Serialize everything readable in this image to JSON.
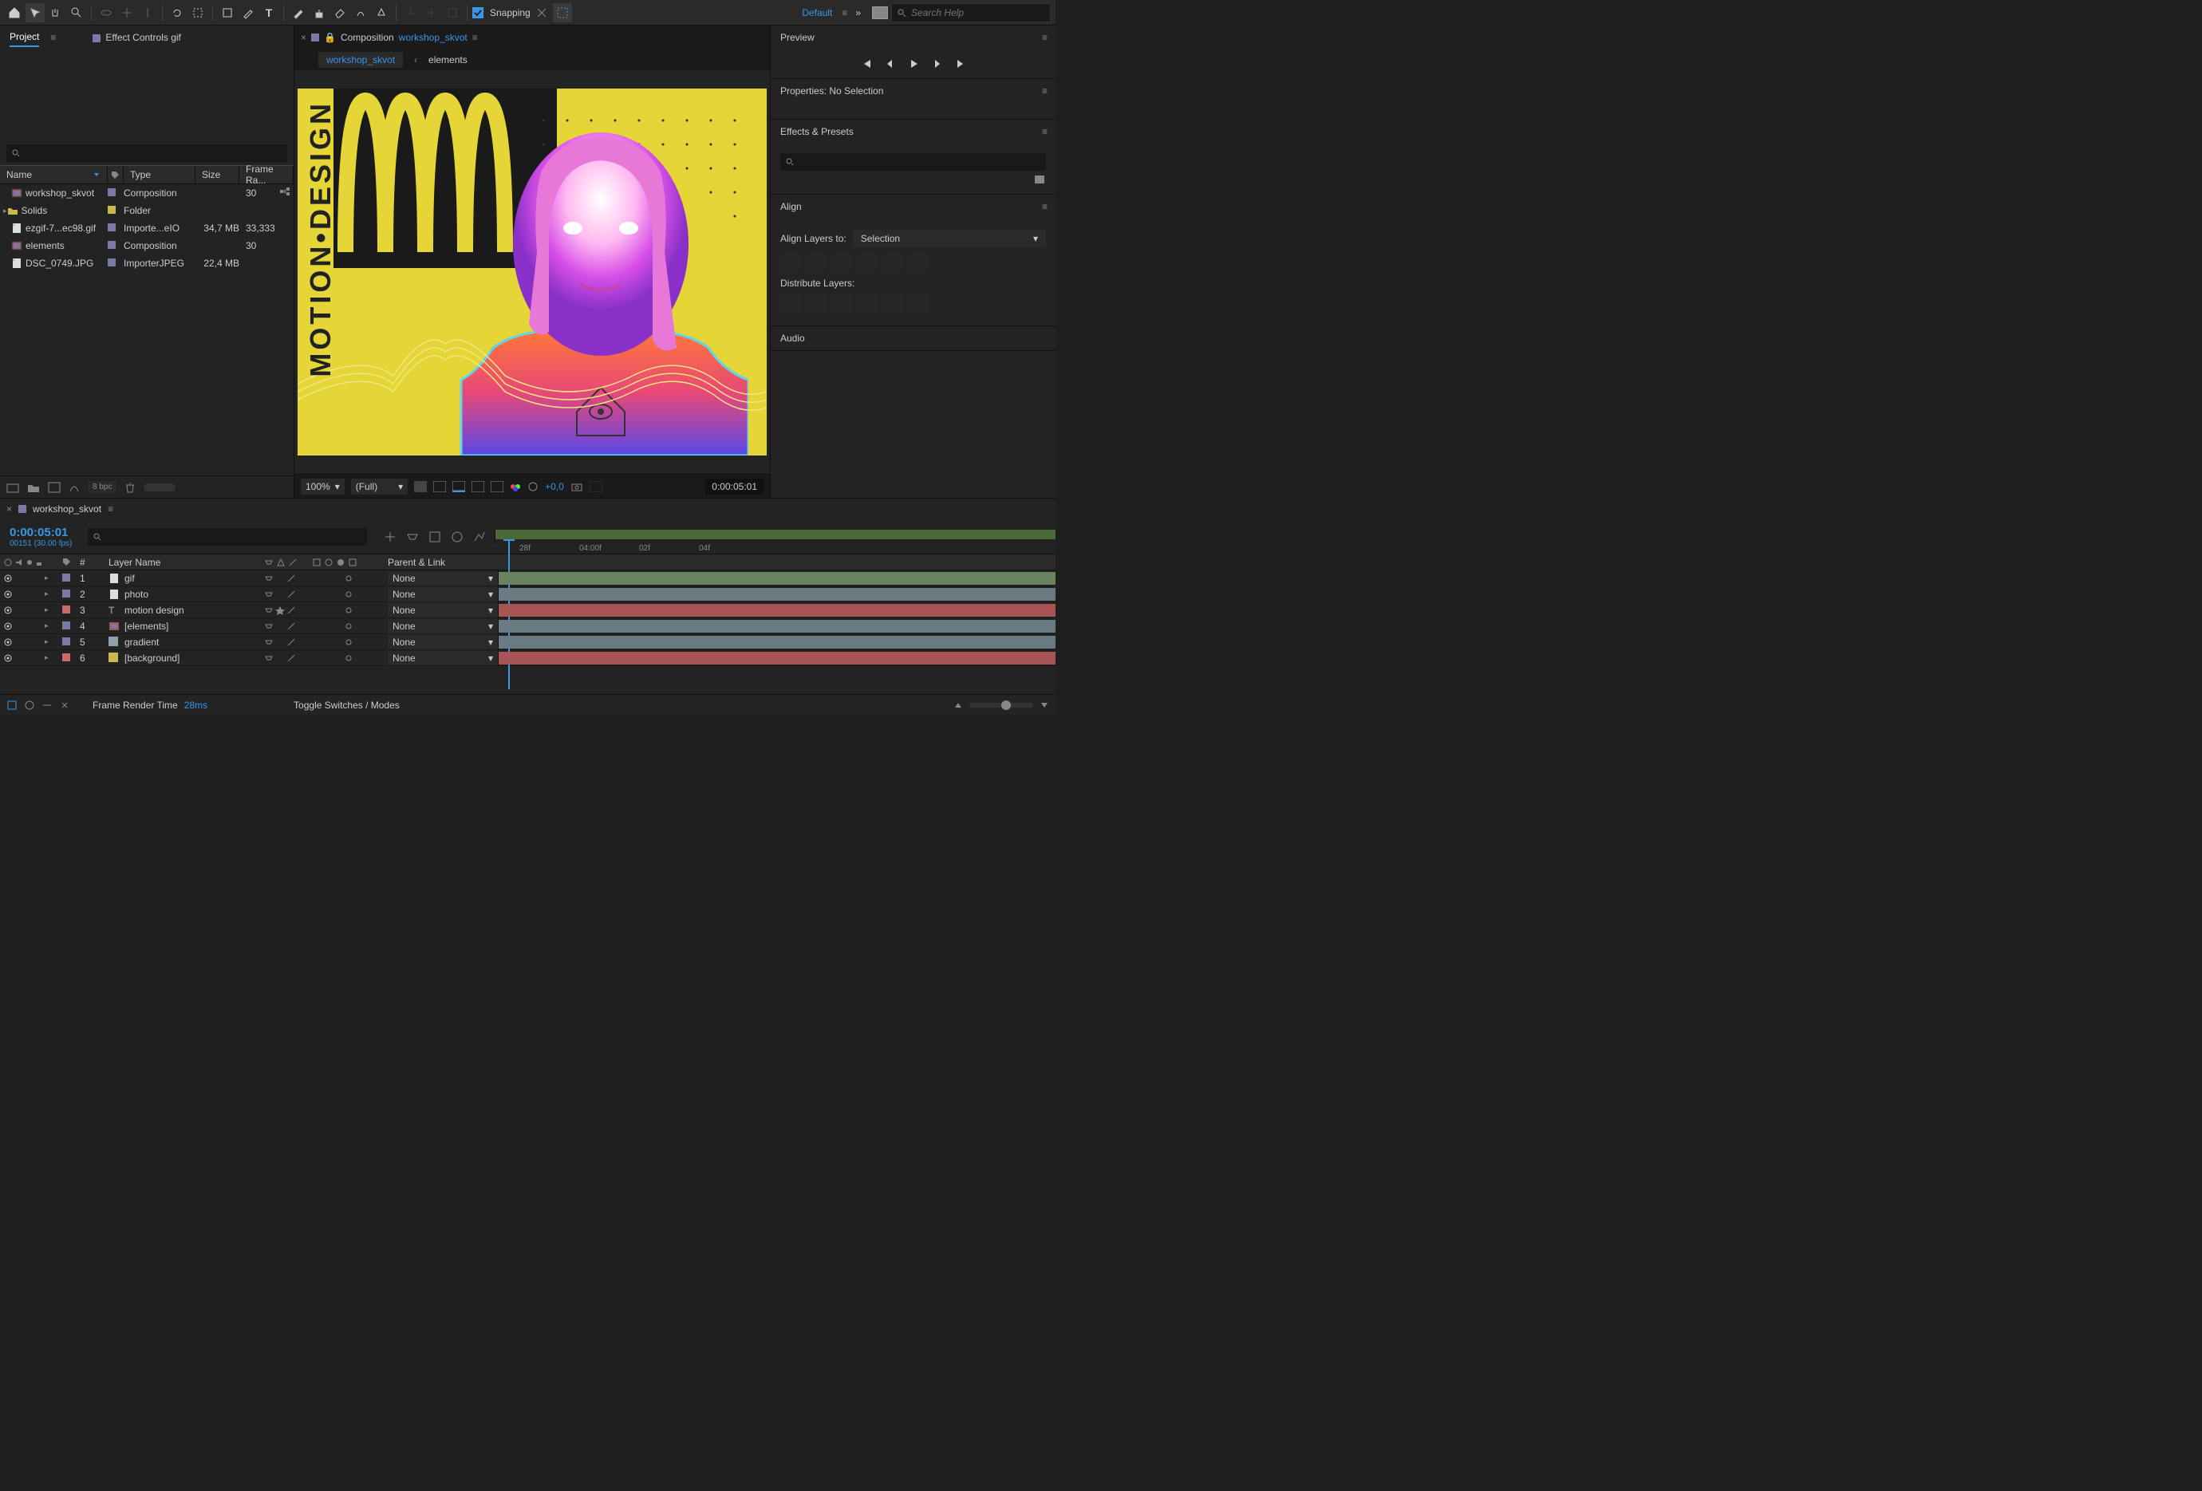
{
  "toolbar": {
    "snapping_label": "Snapping",
    "workspace": "Default",
    "search_placeholder": "Search Help"
  },
  "project_panel": {
    "tab_project": "Project",
    "tab_effect_controls": "Effect Controls gif",
    "columns": {
      "name": "Name",
      "type": "Type",
      "size": "Size",
      "frame": "Frame Ra..."
    },
    "items": [
      {
        "name": "workshop_skvot",
        "type": "Composition",
        "size": "",
        "frame": "30",
        "tag": "#7a7aa8",
        "icon": "comp"
      },
      {
        "name": "Solids",
        "type": "Folder",
        "size": "",
        "frame": "",
        "tag": "#c9b84a",
        "icon": "folder"
      },
      {
        "name": "ezgif-7...ec98.gif",
        "type": "Importe...eIO",
        "size": "34,7 MB",
        "frame": "33,333",
        "tag": "#7a7aa8",
        "icon": "file"
      },
      {
        "name": "elements",
        "type": "Composition",
        "size": "",
        "frame": "30",
        "tag": "#7a7aa8",
        "icon": "comp"
      },
      {
        "name": "DSC_0749.JPG",
        "type": "ImporterJPEG",
        "size": "22,4 MB",
        "frame": "",
        "tag": "#7a7aa8",
        "icon": "file"
      }
    ],
    "bpc": "8 bpc"
  },
  "composition_panel": {
    "title_prefix": "Composition",
    "title_name": "workshop_skvot",
    "breadcrumb_active": "workshop_skvot",
    "breadcrumb_next": "elements",
    "canvas_text": "MOTION•DESIGN",
    "footer": {
      "zoom": "100%",
      "res": "(Full)",
      "exp": "+0,0",
      "timecode": "0:00:05:01"
    }
  },
  "right_panel": {
    "preview": "Preview",
    "properties": "Properties: No Selection",
    "effects": "Effects & Presets",
    "align": "Align",
    "align_layers": "Align Layers to:",
    "align_selection": "Selection",
    "distribute": "Distribute Layers:",
    "audio": "Audio"
  },
  "timeline": {
    "tab_name": "workshop_skvot",
    "timecode": "0:00:05:01",
    "fps": "00151 (30.00 fps)",
    "ticks": [
      "28f",
      "04:00f",
      "02f",
      "04f"
    ],
    "columns": {
      "num": "#",
      "name": "Layer Name",
      "parent": "Parent & Link"
    },
    "layers": [
      {
        "num": "1",
        "name": "gif",
        "icon": "file",
        "color": "#8fa87d",
        "tag": "#7a7aa8",
        "barColor": "#6a8260",
        "parent": "None"
      },
      {
        "num": "2",
        "name": "photo",
        "icon": "file",
        "color": "#8fa0a8",
        "tag": "#7a7aa8",
        "barColor": "#6a7a82",
        "parent": "None"
      },
      {
        "num": "3",
        "name": "motion design",
        "icon": "text",
        "color": "#c96a6a",
        "tag": "#c96a6a",
        "barColor": "#a85454",
        "parent": "None"
      },
      {
        "num": "4",
        "name": "[elements]",
        "icon": "comp",
        "color": "#8fa0a8",
        "tag": "#7a7aa8",
        "barColor": "#6a7a82",
        "parent": "None"
      },
      {
        "num": "5",
        "name": "gradient",
        "icon": "solid",
        "color": "#8fa0a8",
        "tag": "#7a7aa8",
        "barColor": "#6a7a82",
        "parent": "None"
      },
      {
        "num": "6",
        "name": "[background]",
        "icon": "solid",
        "color": "#c9b84a",
        "tag": "#c96a6a",
        "barColor": "#a85454",
        "parent": "None"
      }
    ],
    "footer": {
      "render_label": "Frame Render Time",
      "render_val": "28ms",
      "toggle": "Toggle Switches / Modes"
    }
  }
}
